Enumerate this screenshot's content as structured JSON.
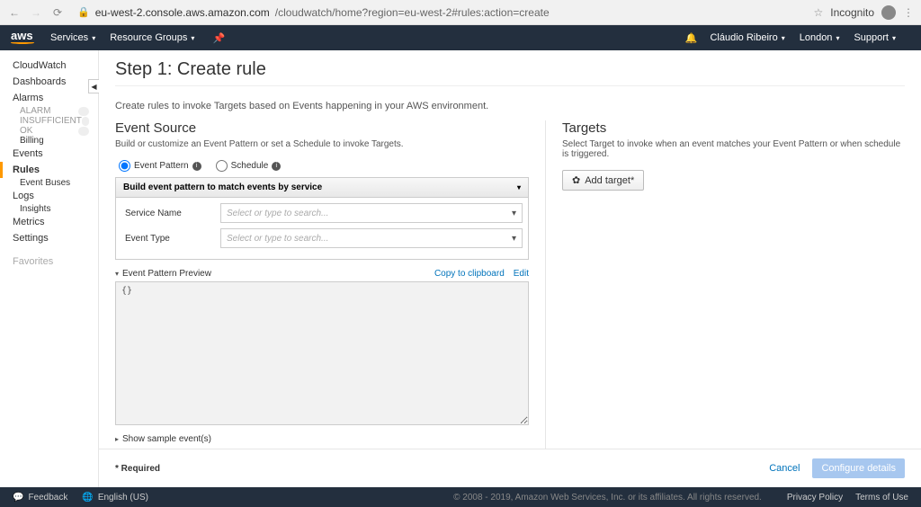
{
  "browser": {
    "url_host": "eu-west-2.console.aws.amazon.com",
    "url_path": "/cloudwatch/home?region=eu-west-2#rules:action=create",
    "incognito": "Incognito"
  },
  "nav": {
    "services": "Services",
    "resource_groups": "Resource Groups",
    "user": "Cláudio Ribeiro",
    "region": "London",
    "support": "Support"
  },
  "sidebar": {
    "cloudwatch": "CloudWatch",
    "dashboards": "Dashboards",
    "alarms": "Alarms",
    "alarm": "ALARM",
    "insufficient": "INSUFFICIENT",
    "ok": "OK",
    "billing": "Billing",
    "events": "Events",
    "rules": "Rules",
    "event_buses": "Event Buses",
    "logs": "Logs",
    "insights": "Insights",
    "metrics": "Metrics",
    "settings": "Settings",
    "favorites": "Favorites"
  },
  "page": {
    "title": "Step 1: Create rule",
    "intro": "Create rules to invoke Targets based on Events happening in your AWS environment."
  },
  "event_source": {
    "title": "Event Source",
    "desc": "Build or customize an Event Pattern or set a Schedule to invoke Targets.",
    "radio_pattern": "Event Pattern",
    "radio_schedule": "Schedule",
    "build_header": "Build event pattern to match events by service",
    "service_name_label": "Service Name",
    "event_type_label": "Event Type",
    "select_placeholder": "Select or type to search...",
    "preview_label": "Event Pattern Preview",
    "copy": "Copy to clipboard",
    "edit": "Edit",
    "preview_content": "{}",
    "sample": "Show sample event(s)"
  },
  "targets": {
    "title": "Targets",
    "desc": "Select Target to invoke when an event matches your Event Pattern or when schedule is triggered.",
    "add_button": "Add target*"
  },
  "footer_row": {
    "required": "* Required",
    "cancel": "Cancel",
    "configure": "Configure details"
  },
  "aws_footer": {
    "feedback": "Feedback",
    "language": "English (US)",
    "copyright": "© 2008 - 2019, Amazon Web Services, Inc. or its affiliates. All rights reserved.",
    "privacy": "Privacy Policy",
    "terms": "Terms of Use"
  }
}
